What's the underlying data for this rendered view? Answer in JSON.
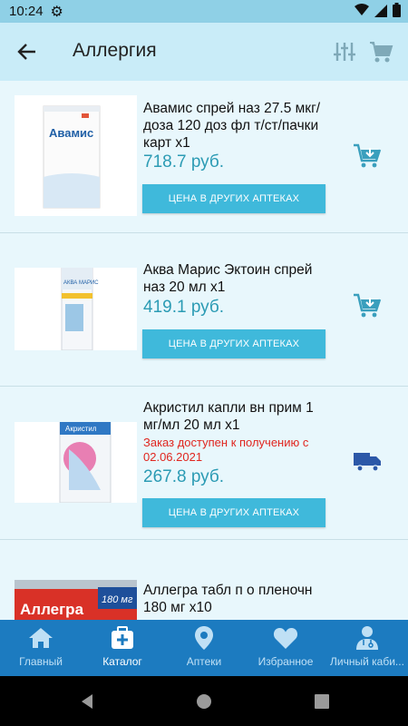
{
  "status": {
    "time": "10:24"
  },
  "header": {
    "title": "Аллергия"
  },
  "products": [
    {
      "name": "Авамис спрей наз 27.5 мкг/доза 120 доз фл т/ст/пачки карт х1",
      "note": "",
      "price": "718.7 руб.",
      "button": "ЦЕНА В ДРУГИХ АПТЕКАХ",
      "action": "add-to-cart",
      "box_label": "Авамис"
    },
    {
      "name": "Аква Марис Эктоин спрей наз 20 мл х1",
      "note": "",
      "price": "419.1 руб.",
      "button": "ЦЕНА В ДРУГИХ АПТЕКАХ",
      "action": "add-to-cart",
      "box_label": "АКВА МАРИС"
    },
    {
      "name": "Акристил капли вн прим 1 мг/мл 20 мл х1",
      "note": "Заказ доступен к получению с 02.06.2021",
      "price": "267.8 руб.",
      "button": "ЦЕНА В ДРУГИХ АПТЕКАХ",
      "action": "delivery",
      "box_label": "Акристил"
    },
    {
      "name": "Аллегра табл п о пленочн 180 мг х10",
      "note": "",
      "price": "",
      "button": "",
      "action": "",
      "box_label": "Аллегра",
      "box_dose": "180 мг"
    }
  ],
  "bottom_nav": [
    {
      "label": "Главный",
      "icon": "home-icon",
      "active": false
    },
    {
      "label": "Каталог",
      "icon": "catalog-icon",
      "active": true
    },
    {
      "label": "Аптеки",
      "icon": "location-pin-icon",
      "active": false
    },
    {
      "label": "Избранное",
      "icon": "heart-icon",
      "active": false
    },
    {
      "label": "Личный каби...",
      "icon": "profile-icon",
      "active": false
    }
  ],
  "colors": {
    "accent": "#3fb9db",
    "price": "#2b9bb4",
    "nav": "#1c7bc0",
    "header": "#c9ecf8",
    "warning": "#e0261f"
  }
}
